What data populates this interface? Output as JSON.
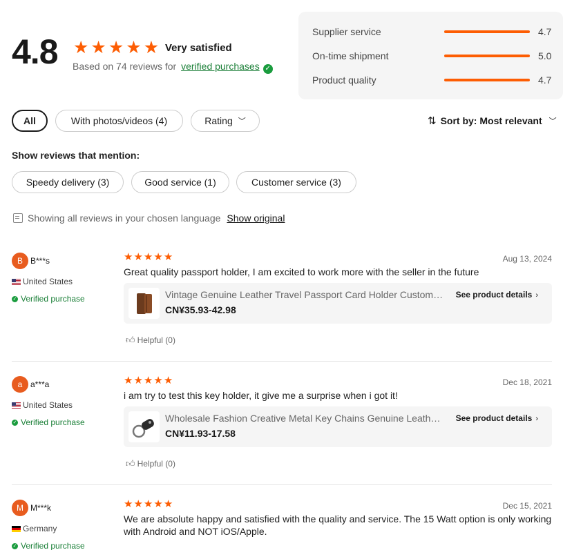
{
  "summary": {
    "score": "4.8",
    "stars": 5,
    "satisfaction": "Very satisfied",
    "based_on": "Based on 74 reviews for",
    "verified_link": "verified purchases"
  },
  "metrics": [
    {
      "label": "Supplier service",
      "value": "4.7"
    },
    {
      "label": "On-time shipment",
      "value": "5.0"
    },
    {
      "label": "Product quality",
      "value": "4.7"
    }
  ],
  "filters": {
    "all": "All",
    "with_photos": "With photos/videos (4)",
    "rating": "Rating"
  },
  "sort": {
    "label": "Sort by: Most relevant"
  },
  "mentions": {
    "heading": "Show reviews that mention:",
    "chips": [
      "Speedy delivery (3)",
      "Good service (1)",
      "Customer service (3)"
    ]
  },
  "language": {
    "notice": "Showing all reviews in your chosen language",
    "show_original": "Show original"
  },
  "reviews": [
    {
      "initial": "B",
      "user": "B***s",
      "country": "United States",
      "verified": "Verified purchase",
      "rating": 5,
      "date": "Aug 13, 2024",
      "text": "Great quality passport holder, I am excited to work more with the seller in the future",
      "product_title": "Vintage Genuine Leather Travel Passport Card Holder Custom Logo",
      "product_price": "CN¥35.93-42.98",
      "see_details": "See product details",
      "helpful": "Helpful (0)"
    },
    {
      "initial": "a",
      "user": "a***a",
      "country": "United States",
      "verified": "Verified purchase",
      "rating": 5,
      "date": "Dec 18, 2021",
      "text": "i am try to test this key holder, it give me a surprise when i got it!",
      "product_title": "Wholesale Fashion Creative Metal Key Chains Genuine Leather Keychain",
      "product_price": "CN¥11.93-17.58",
      "see_details": "See product details",
      "helpful": "Helpful (0)"
    },
    {
      "initial": "M",
      "user": "M***k",
      "country": "Germany",
      "verified": "Verified purchase",
      "rating": 5,
      "date": "Dec 15, 2021",
      "text": "We are absolute happy and satisfied with the quality and service. The 15 Watt option is only working with Android and NOT iOS/Apple."
    }
  ],
  "colors": {
    "accent": "#fd5d03",
    "verified": "#1a7f37"
  }
}
